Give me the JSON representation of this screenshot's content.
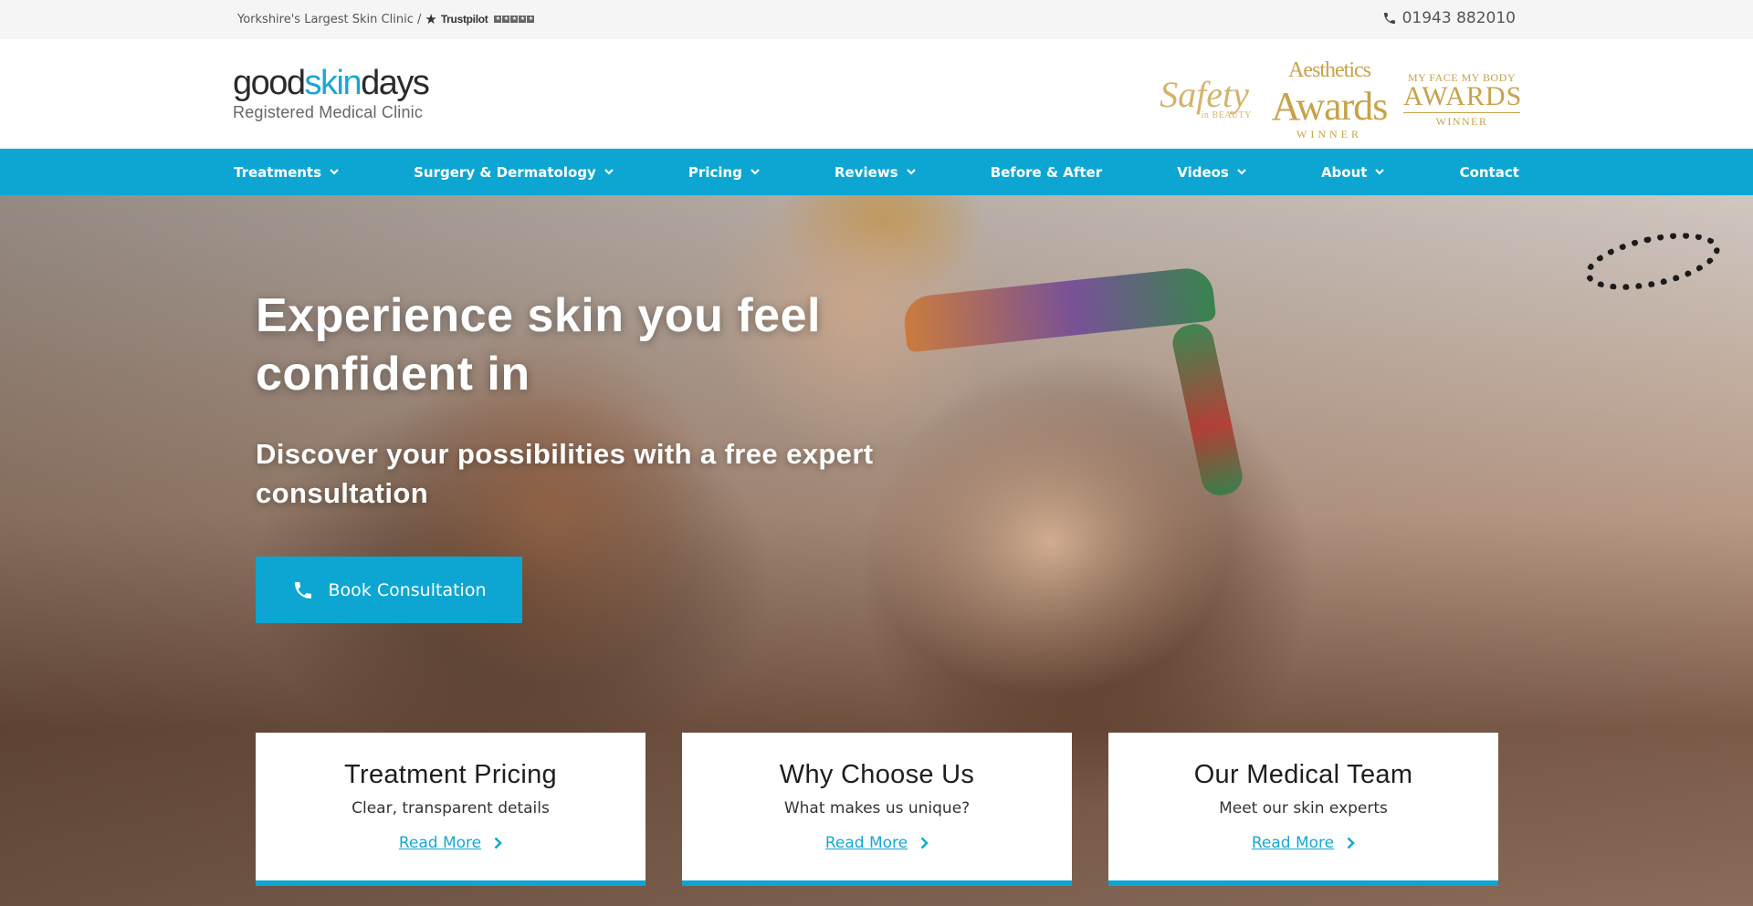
{
  "topbar": {
    "tagline": "Yorkshire's Largest Skin Clinic /",
    "trustpilot": "Trustpilot",
    "phone": "01943 882010"
  },
  "header": {
    "logo": {
      "part1": "good",
      "part2": "skin",
      "part3": "days",
      "subtitle": "Registered Medical Clinic"
    },
    "awards": {
      "safety": {
        "main": "Safety",
        "small": "in BEAUTY"
      },
      "aesthetics": {
        "top": "Aesthetics",
        "main": "Awards",
        "sub": "WINNER"
      },
      "mfmb": {
        "top": "MY FACE MY BODY",
        "main": "AWARDS",
        "sub": "WINNER"
      }
    }
  },
  "nav": {
    "items": [
      {
        "label": "Treatments",
        "dropdown": true
      },
      {
        "label": "Surgery & Dermatology",
        "dropdown": true
      },
      {
        "label": "Pricing",
        "dropdown": true
      },
      {
        "label": "Reviews",
        "dropdown": true
      },
      {
        "label": "Before & After",
        "dropdown": false
      },
      {
        "label": "Videos",
        "dropdown": true
      },
      {
        "label": "About",
        "dropdown": true
      },
      {
        "label": "Contact",
        "dropdown": false
      }
    ]
  },
  "hero": {
    "title": "Experience skin you feel confident in",
    "subtitle": "Discover your possibilities with a free expert consultation",
    "cta_label": "Book Consultation"
  },
  "cards": [
    {
      "title": "Treatment Pricing",
      "subtitle": "Clear, transparent details",
      "link": "Read More"
    },
    {
      "title": "Why Choose Us",
      "subtitle": "What makes us unique?",
      "link": "Read More"
    },
    {
      "title": "Our Medical Team",
      "subtitle": "Meet our skin experts",
      "link": "Read More"
    }
  ],
  "colors": {
    "brand_blue": "#0da6d2",
    "gold": "#c8a24a",
    "topbar_bg": "#f5f5f5"
  },
  "icons": {
    "phone": "phone-icon",
    "chevron": "chevron-down-icon",
    "arrow": "chevron-right-icon",
    "star": "trustpilot-star-icon"
  }
}
